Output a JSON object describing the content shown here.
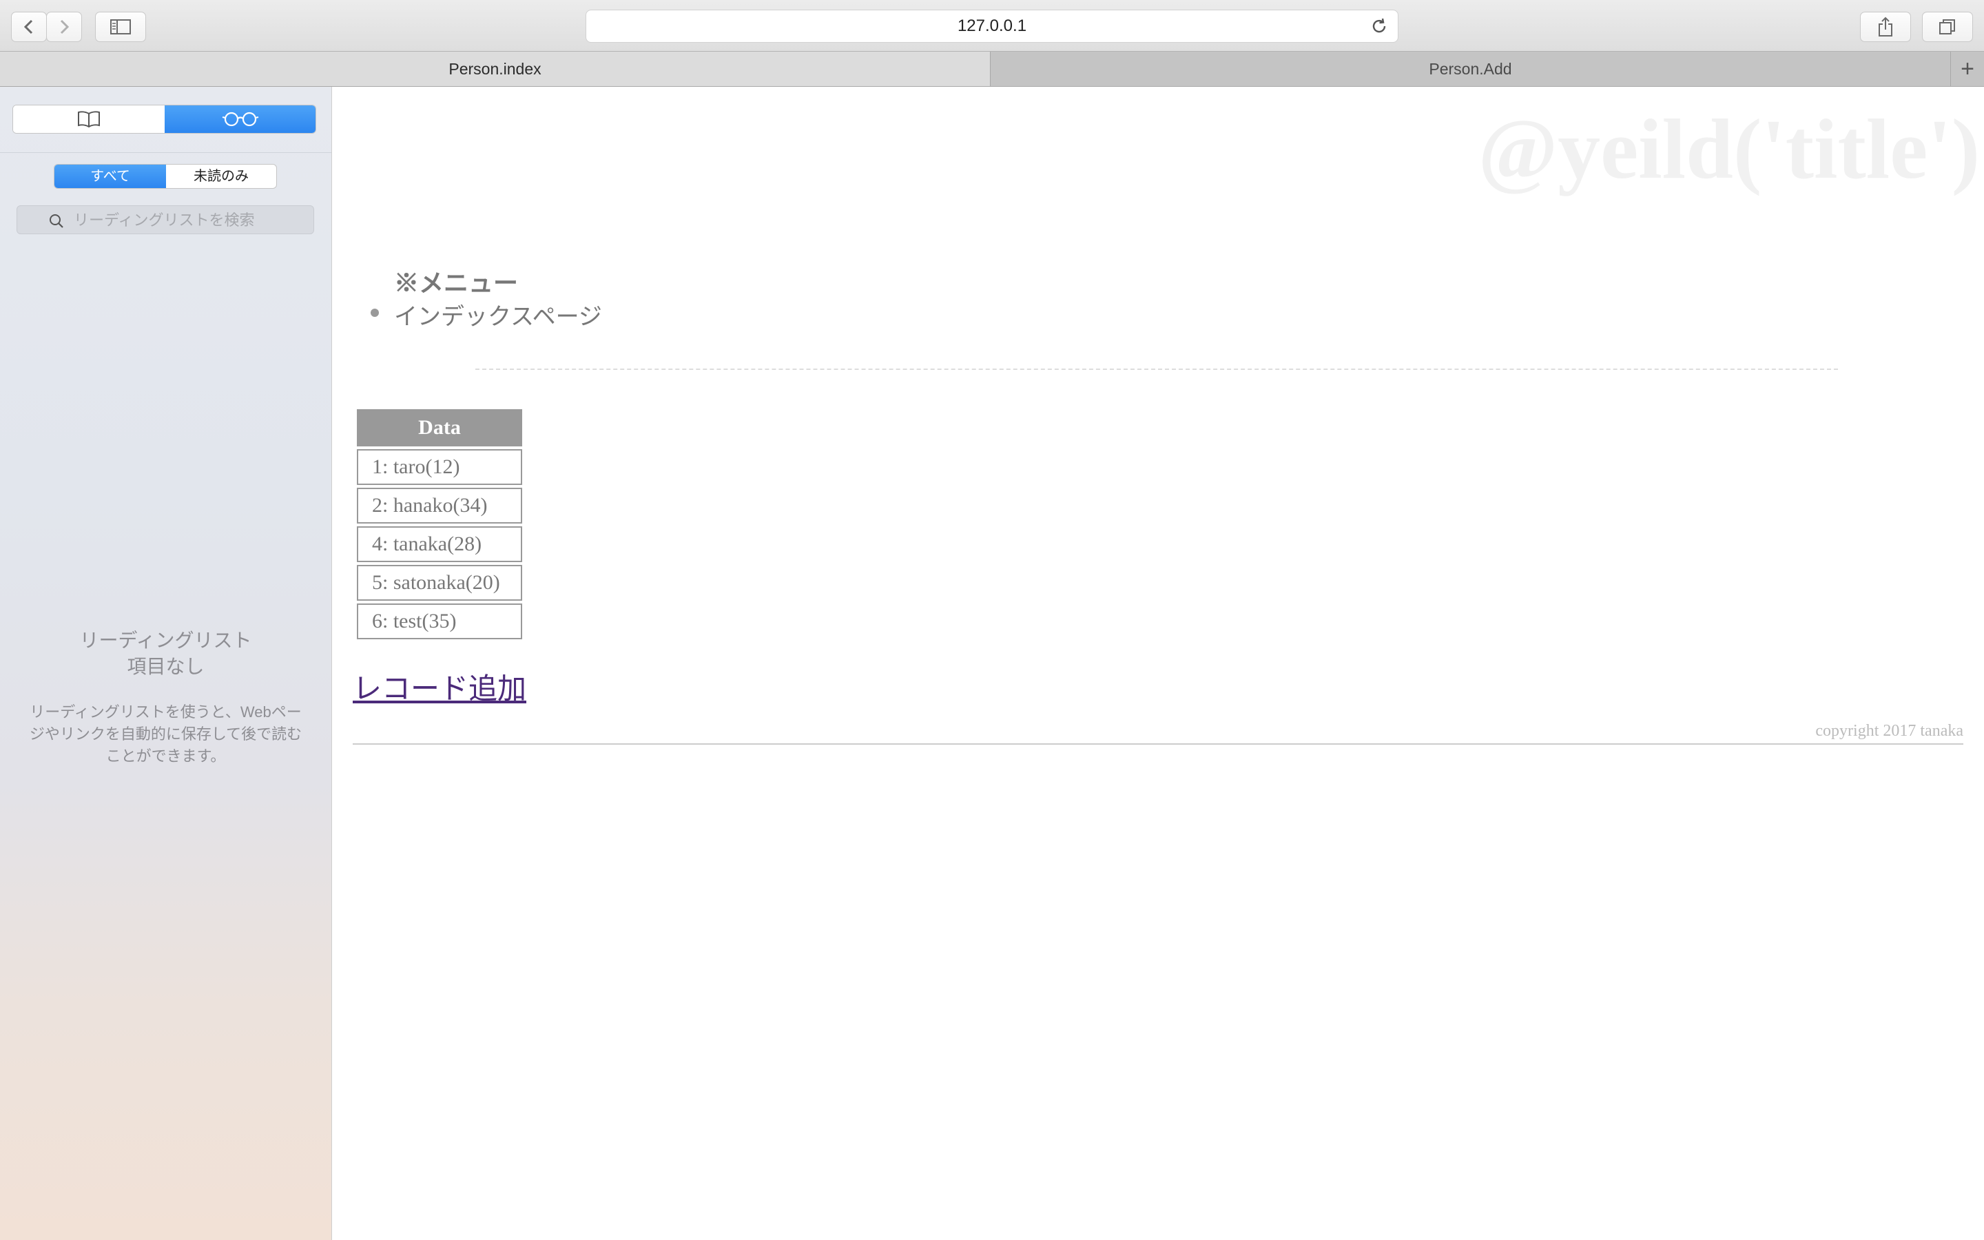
{
  "browser": {
    "url": "127.0.0.1",
    "tabs": [
      {
        "label": "Person.index",
        "active": true
      },
      {
        "label": "Person.Add",
        "active": false
      }
    ],
    "new_tab_label": "+"
  },
  "sidebar": {
    "filter_all": "すべて",
    "filter_unread": "未読のみ",
    "search_placeholder": "リーディングリストを検索",
    "empty_title_line1": "リーディングリスト",
    "empty_title_line2": "項目なし",
    "empty_desc": "リーディングリストを使うと、Webページやリンクを自動的に保存して後で読むことができます。"
  },
  "page": {
    "watermark": "@yeild('title')",
    "menu_title": "※メニュー",
    "menu_items": [
      "インデックスページ"
    ],
    "table_header": "Data",
    "rows": [
      "1: taro(12)",
      "2: hanako(34)",
      "4: tanaka(28)",
      "5: satonaka(20)",
      "6: test(35)"
    ],
    "add_link": "レコード追加",
    "footer": "copyright 2017 tanaka"
  },
  "colors": {
    "accent_blue": "#2d86f0",
    "table_header_bg": "#999999",
    "link_color": "#4b2a7a"
  }
}
